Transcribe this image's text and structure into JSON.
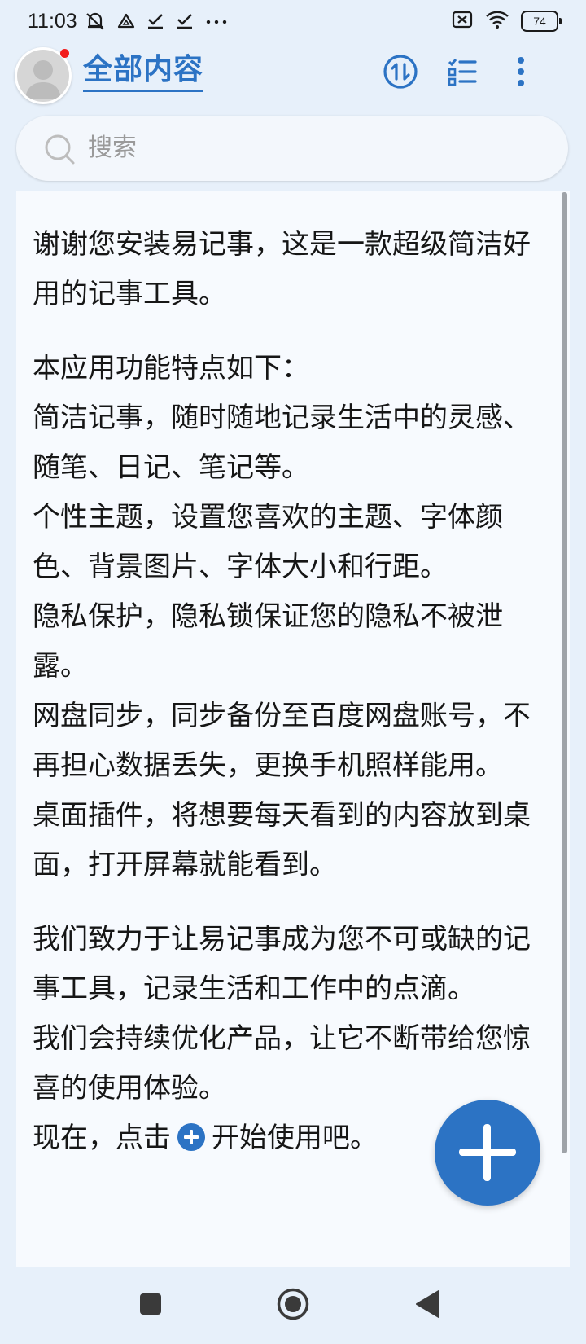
{
  "status_bar": {
    "time": "11:03",
    "icons": [
      "mute-icon",
      "drive-icon",
      "check-icon",
      "check-icon",
      "more-icon"
    ],
    "right_icons": [
      "sim-off-icon",
      "wifi-icon"
    ],
    "battery": "74"
  },
  "header": {
    "title": "全部内容",
    "avatar_has_notification": true,
    "actions": [
      "sort-icon",
      "checklist-icon",
      "more-vert-icon"
    ]
  },
  "search": {
    "placeholder": "搜索"
  },
  "note": {
    "intro": "谢谢您安装易记事，这是一款超级简洁好用的记事工具。",
    "features_heading": "本应用功能特点如下：",
    "features": [
      "简洁记事，随时随地记录生活中的灵感、随笔、日记、笔记等。",
      "个性主题，设置您喜欢的主题、字体颜色、背景图片、字体大小和行距。",
      "隐私保护，隐私锁保证您的隐私不被泄露。",
      "网盘同步，同步备份至百度网盘账号，不再担心数据丢失，更换手机照样能用。",
      "桌面插件，将想要每天看到的内容放到桌面，打开屏幕就能看到。"
    ],
    "closing_1": "我们致力于让易记事成为您不可或缺的记事工具，记录生活和工作中的点滴。",
    "closing_2": "我们会持续优化产品，让它不断带给您惊喜的使用体验。",
    "cta_before": "现在，点击",
    "cta_after": "开始使用吧。"
  },
  "colors": {
    "accent": "#2c73c4",
    "background": "#e7f0fa",
    "card": "#f7fafe"
  },
  "navbar": [
    "square-icon",
    "home-circle-icon",
    "back-triangle-icon"
  ]
}
